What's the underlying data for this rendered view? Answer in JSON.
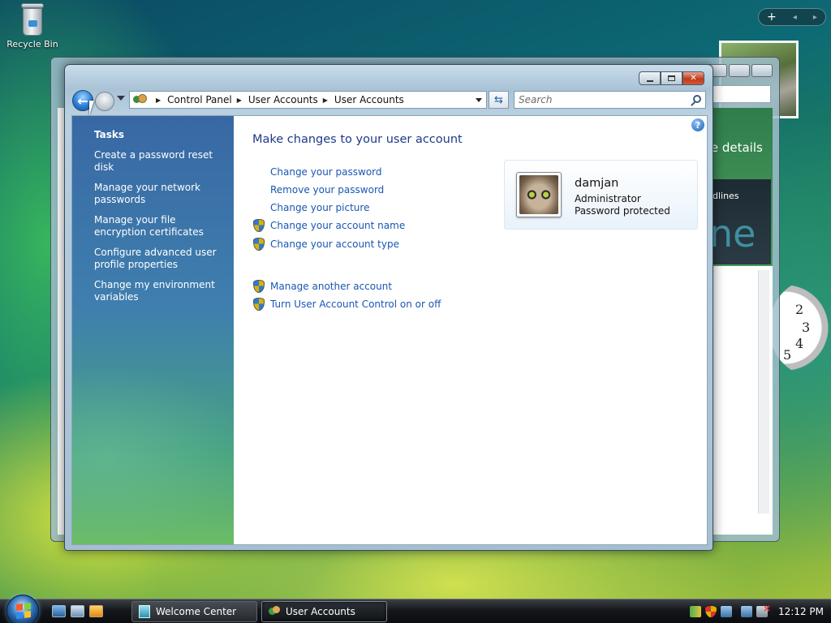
{
  "desktop": {
    "recycle_bin_label": "Recycle Bin",
    "gadget_controls": [
      "+",
      "◂",
      "▸"
    ],
    "clock_numbers": [
      "2",
      "3",
      "4",
      "5"
    ],
    "bg_window_text_1": "re details",
    "bg_window_text_2": "dlines",
    "bg_window_text_3": "ne"
  },
  "window": {
    "address": {
      "crumbs": [
        "Control Panel",
        "User Accounts",
        "User Accounts"
      ]
    },
    "search_placeholder": "Search",
    "tasks": {
      "title": "Tasks",
      "links": [
        "Create a password reset disk",
        "Manage your network passwords",
        "Manage your file encryption certificates",
        "Configure advanced user profile properties",
        "Change my environment variables"
      ]
    },
    "main": {
      "title": "Make changes to your user account",
      "links": [
        "Change your password",
        "Remove your password",
        "Change your picture",
        "Change your account name",
        "Change your account type",
        "Manage another account",
        "Turn User Account Control on or off"
      ],
      "help_label": "?"
    },
    "account": {
      "name": "damjan",
      "role": "Administrator",
      "status": "Password protected"
    }
  },
  "taskbar": {
    "buttons": [
      "Welcome Center",
      "User Accounts"
    ],
    "time": "12:12 PM"
  },
  "icons": {
    "shield": "uac-shield-icon",
    "back": "back-arrow-icon",
    "forward": "forward-arrow-icon",
    "refresh": "refresh-icon",
    "search": "search-icon"
  },
  "colors": {
    "link": "#1a56b3",
    "title": "#1e3a8a",
    "tasks_pane_top": "#3868a4",
    "tasks_pane_bottom": "#6cbc66"
  }
}
